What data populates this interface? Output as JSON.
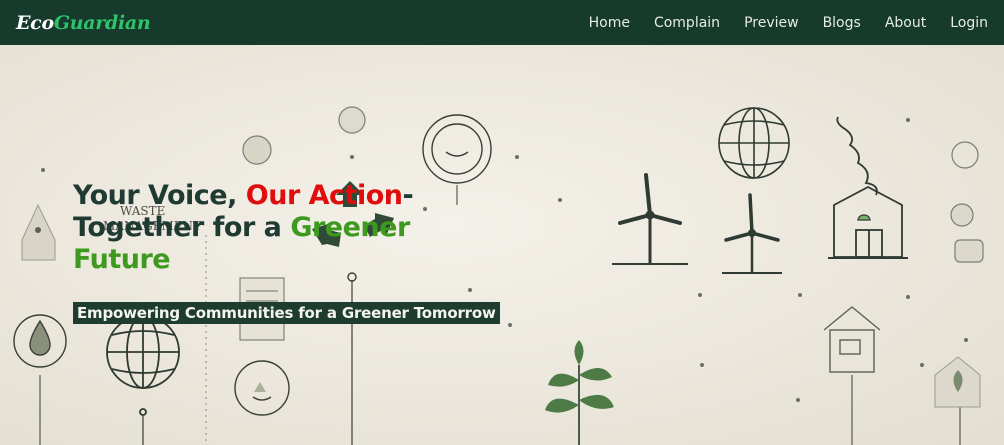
{
  "brand": {
    "part1": "Eco",
    "part2": "Guardian"
  },
  "nav": {
    "items": [
      "Home",
      "Complain",
      "Preview",
      "Blogs",
      "About",
      "Login"
    ]
  },
  "hero": {
    "line1_a": "Your Voice, ",
    "line1_b": "Our Action",
    "line1_c": "-",
    "line2_a": "Together for a ",
    "line2_b": "Greener",
    "line3": "Future",
    "subtitle": "Empowering Communities for a Greener Tomorrow",
    "art_text_1": "WASTE",
    "art_text_2": "MANAGEMENT"
  },
  "colors": {
    "navbar": "#163a2b",
    "brand_accent": "#2fc46a",
    "headline_red": "#e00d0d",
    "headline_green": "#3e9a1e",
    "subtitle_bg": "#1e3d30"
  }
}
